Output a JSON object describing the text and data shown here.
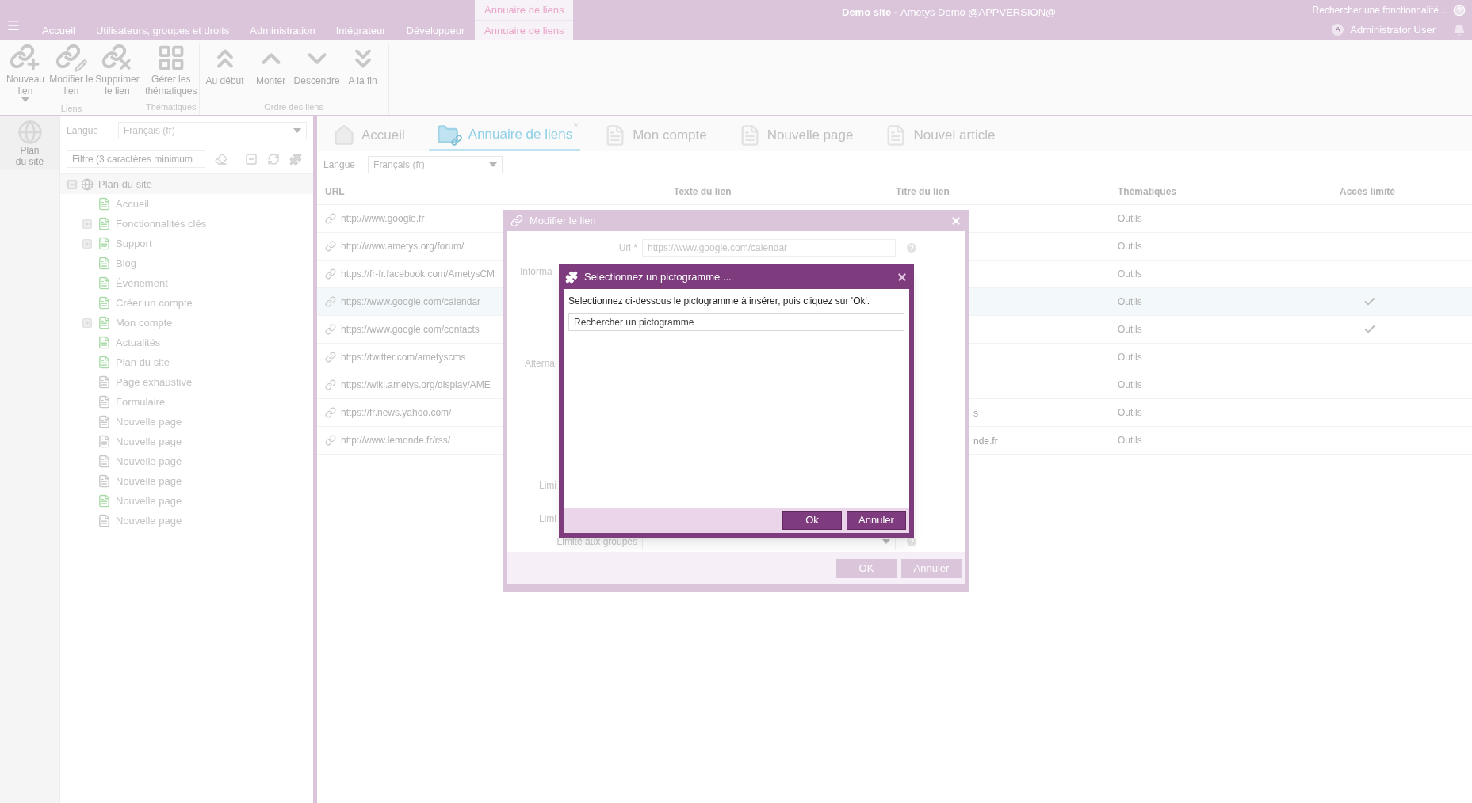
{
  "top_bar": {
    "menu_tabs": [
      {
        "label": "Accueil",
        "selected": false
      },
      {
        "label": "Utilisateurs, groupes et droits",
        "selected": false
      },
      {
        "label": "Administration",
        "selected": false
      },
      {
        "label": "Intégrateur",
        "selected": false
      },
      {
        "label": "Développeur",
        "selected": false
      },
      {
        "label": "Annuaire de liens",
        "selected": true
      }
    ],
    "context_group": "Annuaire de liens",
    "site_name": "Demo site -",
    "app_name": "Ametys Demo @APPVERSION@",
    "search": {
      "placeholder": "Rechercher une fonctionnalité..."
    },
    "user": {
      "initial": "A",
      "name": "Administrator User"
    }
  },
  "ribbon": {
    "groups": [
      {
        "label": "Liens",
        "buttons": [
          {
            "label": "Nouveau lien",
            "dropdown": true
          },
          {
            "label": "Modifier le lien",
            "dropdown": false
          },
          {
            "label": "Supprimer le lien",
            "dropdown": false
          }
        ]
      },
      {
        "label": "Thématiques",
        "buttons": [
          {
            "label": "Gérer les thématiques",
            "dropdown": false
          }
        ]
      },
      {
        "label": "Ordre des liens",
        "buttons": [
          {
            "label": "Au début",
            "dropdown": false
          },
          {
            "label": "Monter",
            "dropdown": false
          },
          {
            "label": "Descendre",
            "dropdown": false
          },
          {
            "label": "A la fin",
            "dropdown": false
          }
        ]
      }
    ]
  },
  "sidebar": {
    "tool": "Plan du site",
    "language_label": "Langue",
    "language": "Français (fr)",
    "filter": {
      "placeholder": "Filtre (3 caractères minimum"
    },
    "tree": {
      "label": "Plan du site",
      "expanded": true,
      "children": [
        {
          "label": "Accueil",
          "kind": "leaf",
          "color": "#a8dba8"
        },
        {
          "label": "Fonctionnalités clés",
          "kind": "folder",
          "color": "#a8dba8"
        },
        {
          "label": "Support",
          "kind": "folder",
          "color": "#a8dba8"
        },
        {
          "label": "Blog",
          "kind": "leaf",
          "color": "#a8dba8"
        },
        {
          "label": "Évènement",
          "kind": "leaf",
          "color": "#a8dba8"
        },
        {
          "label": "Créer un compte",
          "kind": "leaf",
          "color": "#a8dba8"
        },
        {
          "label": "Mon compte",
          "kind": "folder",
          "color": "#a8dba8"
        },
        {
          "label": "Actualités",
          "kind": "leaf",
          "color": "#a8dba8"
        },
        {
          "label": "Plan du site",
          "kind": "leaf",
          "color": "#a8dba8"
        },
        {
          "label": "Page exhaustive",
          "kind": "leaf",
          "color": "#c8c8c8"
        },
        {
          "label": "Formulaire",
          "kind": "leaf",
          "color": "#c8c8c8"
        },
        {
          "label": "Nouvelle page",
          "kind": "leaf",
          "color": "#c8c8c8"
        },
        {
          "label": "Nouvelle page",
          "kind": "leaf",
          "color": "#c8c8c8"
        },
        {
          "label": "Nouvelle page",
          "kind": "leaf",
          "color": "#c8c8c8"
        },
        {
          "label": "Nouvelle page",
          "kind": "leaf",
          "color": "#c8c8c8"
        },
        {
          "label": "Nouvelle page",
          "kind": "leaf",
          "color": "#a8dba8"
        },
        {
          "label": "Nouvelle page",
          "kind": "leaf",
          "color": "#c8c8c8"
        }
      ]
    }
  },
  "content_tabs": [
    {
      "label": "Accueil",
      "kind": "home",
      "selected": false,
      "closable": false
    },
    {
      "label": "Annuaire de liens",
      "kind": "directory",
      "selected": true,
      "closable": true
    },
    {
      "label": "Mon compte",
      "kind": "page",
      "selected": false,
      "closable": false
    },
    {
      "label": "Nouvelle page",
      "kind": "page",
      "selected": false,
      "closable": false
    },
    {
      "label": "Nouvel article",
      "kind": "page",
      "selected": false,
      "closable": false
    }
  ],
  "links": {
    "language_label": "Langue",
    "language": "Français (fr)",
    "columns": [
      "URL",
      "Texte du lien",
      "Titre du lien",
      "Thématiques",
      "Accès limité"
    ],
    "rows": [
      {
        "url": "http://www.google.fr",
        "theme": "Outils",
        "restricted": false,
        "selected": false
      },
      {
        "url": "http://www.ametys.org/forum/",
        "theme": "Outils",
        "restricted": false,
        "selected": false
      },
      {
        "url": "https://fr-fr.facebook.com/AmetysCM",
        "theme": "Outils",
        "restricted": false,
        "selected": false
      },
      {
        "url": "https://www.google.com/calendar",
        "theme": "Outils",
        "restricted": true,
        "selected": true
      },
      {
        "url": "https://www.google.com/contacts",
        "theme": "Outils",
        "restricted": true,
        "selected": false
      },
      {
        "url": "https://twitter.com/ametyscms",
        "theme": "Outils",
        "restricted": false,
        "selected": false
      },
      {
        "url": "https://wiki.ametys.org/display/AME",
        "theme": "Outils",
        "restricted": false,
        "selected": false
      },
      {
        "url": "https://fr.news.yahoo.com/",
        "title": "s",
        "theme": "Outils",
        "restricted": false,
        "selected": false
      },
      {
        "url": "http://www.lemonde.fr/rss/",
        "title": "nde.fr",
        "theme": "Outils",
        "restricted": false,
        "selected": false
      }
    ]
  },
  "edit_dialog": {
    "title": "Modifier le lien",
    "fields": [
      {
        "kind": "input",
        "label": "Url *",
        "value": "https://www.google.com/calendar"
      },
      {
        "kind": "partial",
        "label": "Informa"
      },
      {
        "kind": "partial",
        "label": "Alterna"
      },
      {
        "kind": "partial",
        "label": "Limi"
      },
      {
        "kind": "partial",
        "label": "Limi"
      },
      {
        "kind": "combo",
        "label": "Limité aux groupes"
      }
    ],
    "buttons": [
      "OK",
      "Annuler"
    ]
  },
  "picto_dialog": {
    "title": "Selectionnez un pictogramme ...",
    "instructions": "Selectionnez ci-dessous le pictogramme à insérer, puis cliquez sur 'Ok'.",
    "search": {
      "placeholder": "Rechercher un pictogramme"
    },
    "buttons": [
      "Ok",
      "Annuler"
    ]
  }
}
